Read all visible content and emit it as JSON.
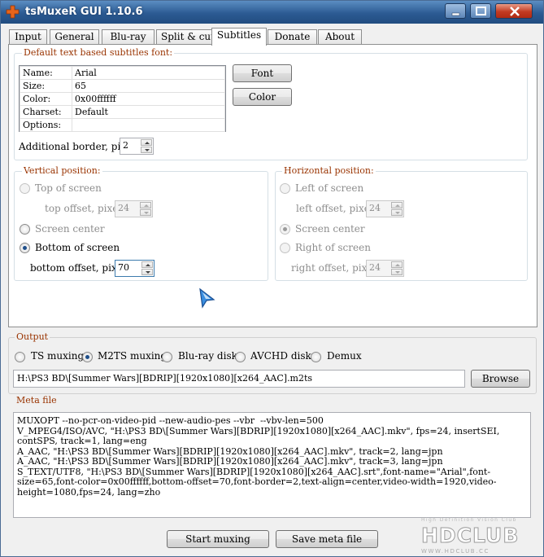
{
  "window": {
    "title": "tsMuxeR GUI 1.10.6"
  },
  "tabs": [
    {
      "label": "Input"
    },
    {
      "label": "General"
    },
    {
      "label": "Blu-ray"
    },
    {
      "label": "Split & cut"
    },
    {
      "label": "Subtitles"
    },
    {
      "label": "Donate"
    },
    {
      "label": "About"
    }
  ],
  "font_group": {
    "legend": "Default text based subtitles font:",
    "rows": [
      {
        "key": "Name:",
        "value": "Arial"
      },
      {
        "key": "Size:",
        "value": "65"
      },
      {
        "key": "Color:",
        "value": "0x00ffffff"
      },
      {
        "key": "Charset:",
        "value": "Default"
      },
      {
        "key": "Options:",
        "value": ""
      }
    ],
    "font_button": "Font",
    "color_button": "Color",
    "border_label": "Additional border, pixels:",
    "border_value": "2"
  },
  "vertical": {
    "legend": "Vertical position:",
    "top_label": "Top of screen",
    "top_offset_label": "top offset, pixels:",
    "top_offset_value": "24",
    "center_label": "Screen center",
    "bottom_label": "Bottom of screen",
    "bottom_offset_label": "bottom offset, pixels:",
    "bottom_offset_value": "70"
  },
  "horizontal": {
    "legend": "Horizontal position:",
    "left_label": "Left of screen",
    "left_offset_label": "left offset, pixels:",
    "left_offset_value": "24",
    "center_label": "Screen center",
    "right_label": "Right of screen",
    "right_offset_label": "right offset, pixels:",
    "right_offset_value": "24"
  },
  "output": {
    "legend": "Output",
    "modes": [
      "TS muxing",
      "M2TS muxing",
      "Blu-ray disk",
      "AVCHD disk",
      "Demux"
    ],
    "selected": "M2TS muxing",
    "path": "H:\\PS3 BD\\[Summer Wars][BDRIP][1920x1080][x264_AAC].m2ts",
    "browse": "Browse"
  },
  "meta": {
    "legend": "Meta file",
    "lines": [
      "MUXOPT --no-pcr-on-video-pid --new-audio-pes --vbr  --vbv-len=500",
      "V_MPEG4/ISO/AVC, \"H:\\PS3 BD\\[Summer Wars][BDRIP][1920x1080][x264_AAC].mkv\", fps=24, insertSEI, contSPS, track=1, lang=eng",
      "A_AAC, \"H:\\PS3 BD\\[Summer Wars][BDRIP][1920x1080][x264_AAC].mkv\", track=2, lang=jpn",
      "A_AAC, \"H:\\PS3 BD\\[Summer Wars][BDRIP][1920x1080][x264_AAC].mkv\", track=3, lang=jpn",
      "S_TEXT/UTF8, \"H:\\PS3 BD\\[Summer Wars][BDRIP][1920x1080][x264_AAC].srt\",font-name=\"Arial\",font-size=65,font-color=0x00ffffff,bottom-offset=70,font-border=2,text-align=center,video-width=1920,video-height=1080,fps=24, lang=zho"
    ]
  },
  "footer": {
    "start": "Start muxing",
    "save": "Save meta file"
  },
  "watermark": {
    "tagline": "High Definition Vision Club",
    "brand": "HDCLUB",
    "url": "WWW.HDCLUB.CC"
  },
  "colors": {
    "legend": "#993300",
    "title_bar": "#2c5b93",
    "close_button": "#c23b22"
  }
}
